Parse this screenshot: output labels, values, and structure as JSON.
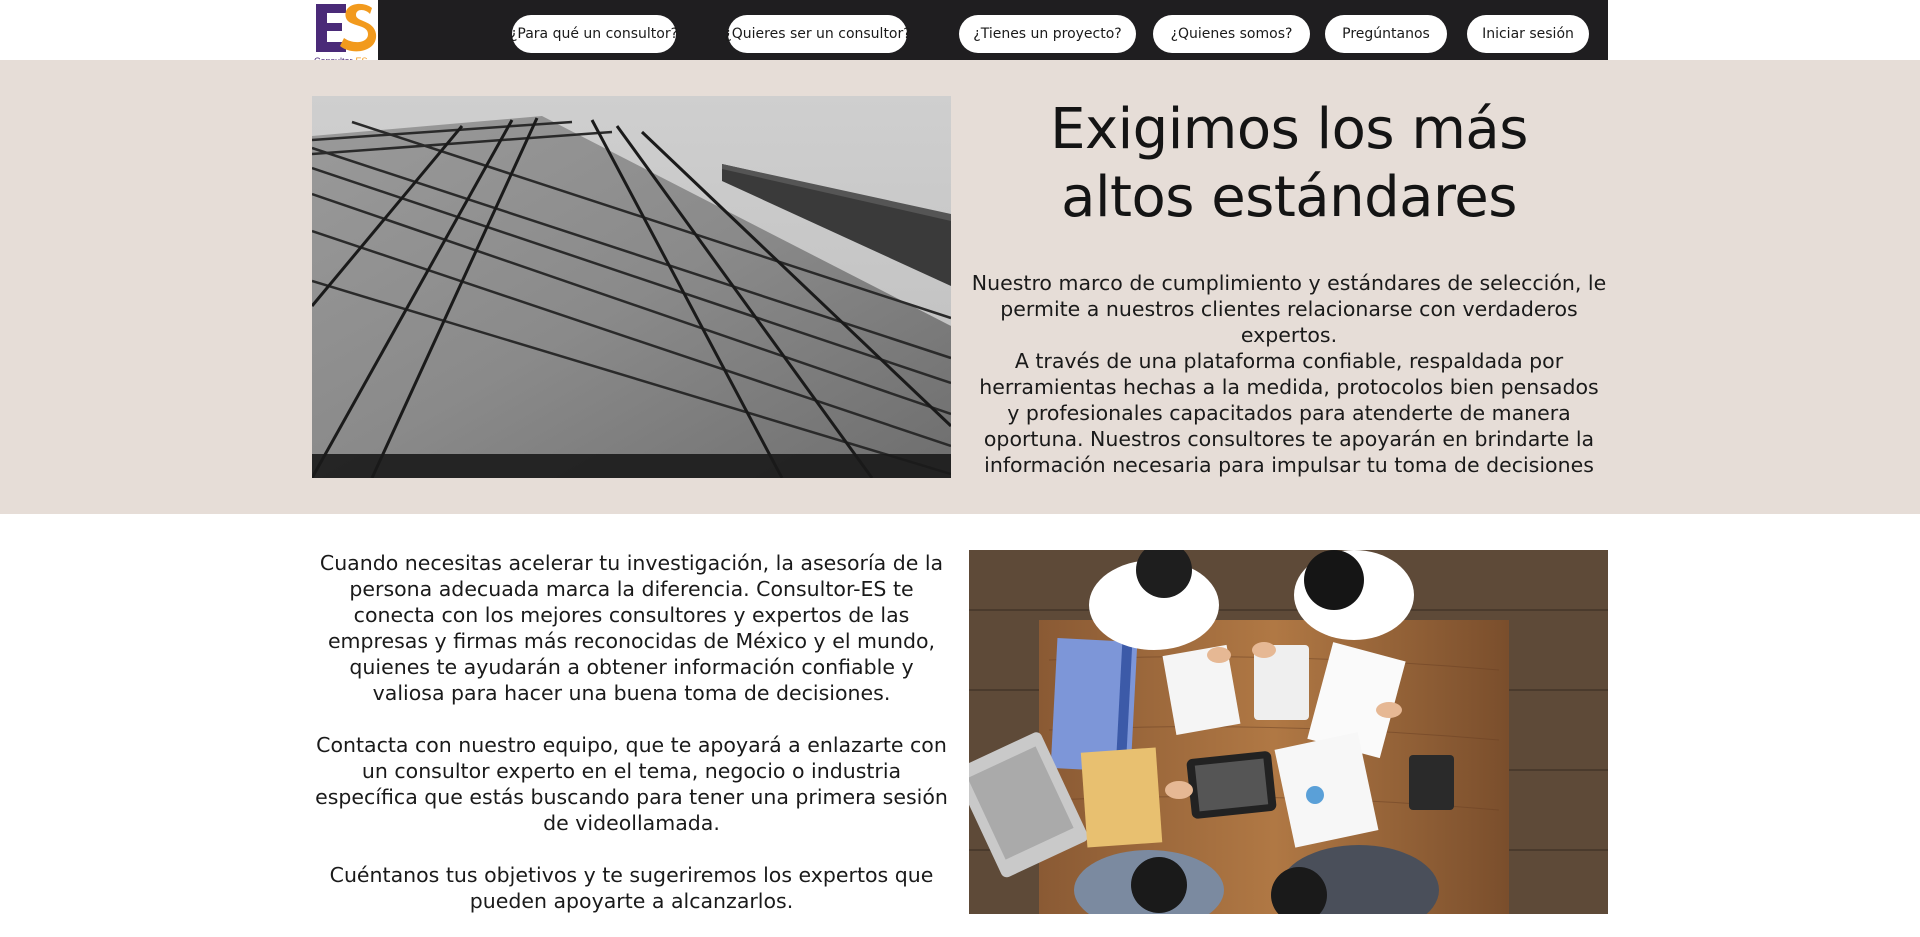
{
  "logo": {
    "monogram_left": "E",
    "monogram_right": "S",
    "caption_main": "Consultor-",
    "caption_accent": "ES"
  },
  "nav": {
    "items": [
      {
        "label": "¿Para qué un consultor?"
      },
      {
        "label": "¿Quieres ser un consultor?"
      },
      {
        "label": "¿Tienes un proyecto?"
      },
      {
        "label": "¿Quienes somos?"
      },
      {
        "label": "Pregúntanos"
      },
      {
        "label": "Iniciar sesión"
      }
    ]
  },
  "hero": {
    "title_line1": "Exigimos los más",
    "title_line2": "altos estándares",
    "paragraph1": "Nuestro marco de cumplimiento y estándares de selección, le permite a nuestros clientes relacionarse con verdaderos expertos.",
    "paragraph2": "A través de una plataforma confiable, respaldada por herramientas hechas a la medida, protocolos bien pensados y profesionales capacitados para atenderte de manera oportuna. Nuestros consultores te apoyarán en brindarte la información necesaria para impulsar tu toma de decisiones"
  },
  "content": {
    "paragraph1": "Cuando necesitas acelerar tu investigación, la asesoría de la persona adecuada marca la diferencia. Consultor-ES te conecta con los mejores consultores y expertos de las empresas y firmas más reconocidas de México y el mundo, quienes te ayudarán a obtener información confiable y valiosa para hacer una buena toma de decisiones.",
    "paragraph2": "Contacta con nuestro equipo, que te apoyará a enlazarte con un consultor experto en el tema, negocio o industria específica que estás buscando para tener una primera sesión de videollamada.",
    "paragraph3": "Cuéntanos tus objetivos y te sugeriremos los expertos que pueden apoyarte a alcanzarlos."
  },
  "colors": {
    "header_bg": "#1f1e20",
    "section_bg": "#e6ddd7",
    "logo_purple": "#4a2a78",
    "logo_orange": "#f29a1d"
  }
}
